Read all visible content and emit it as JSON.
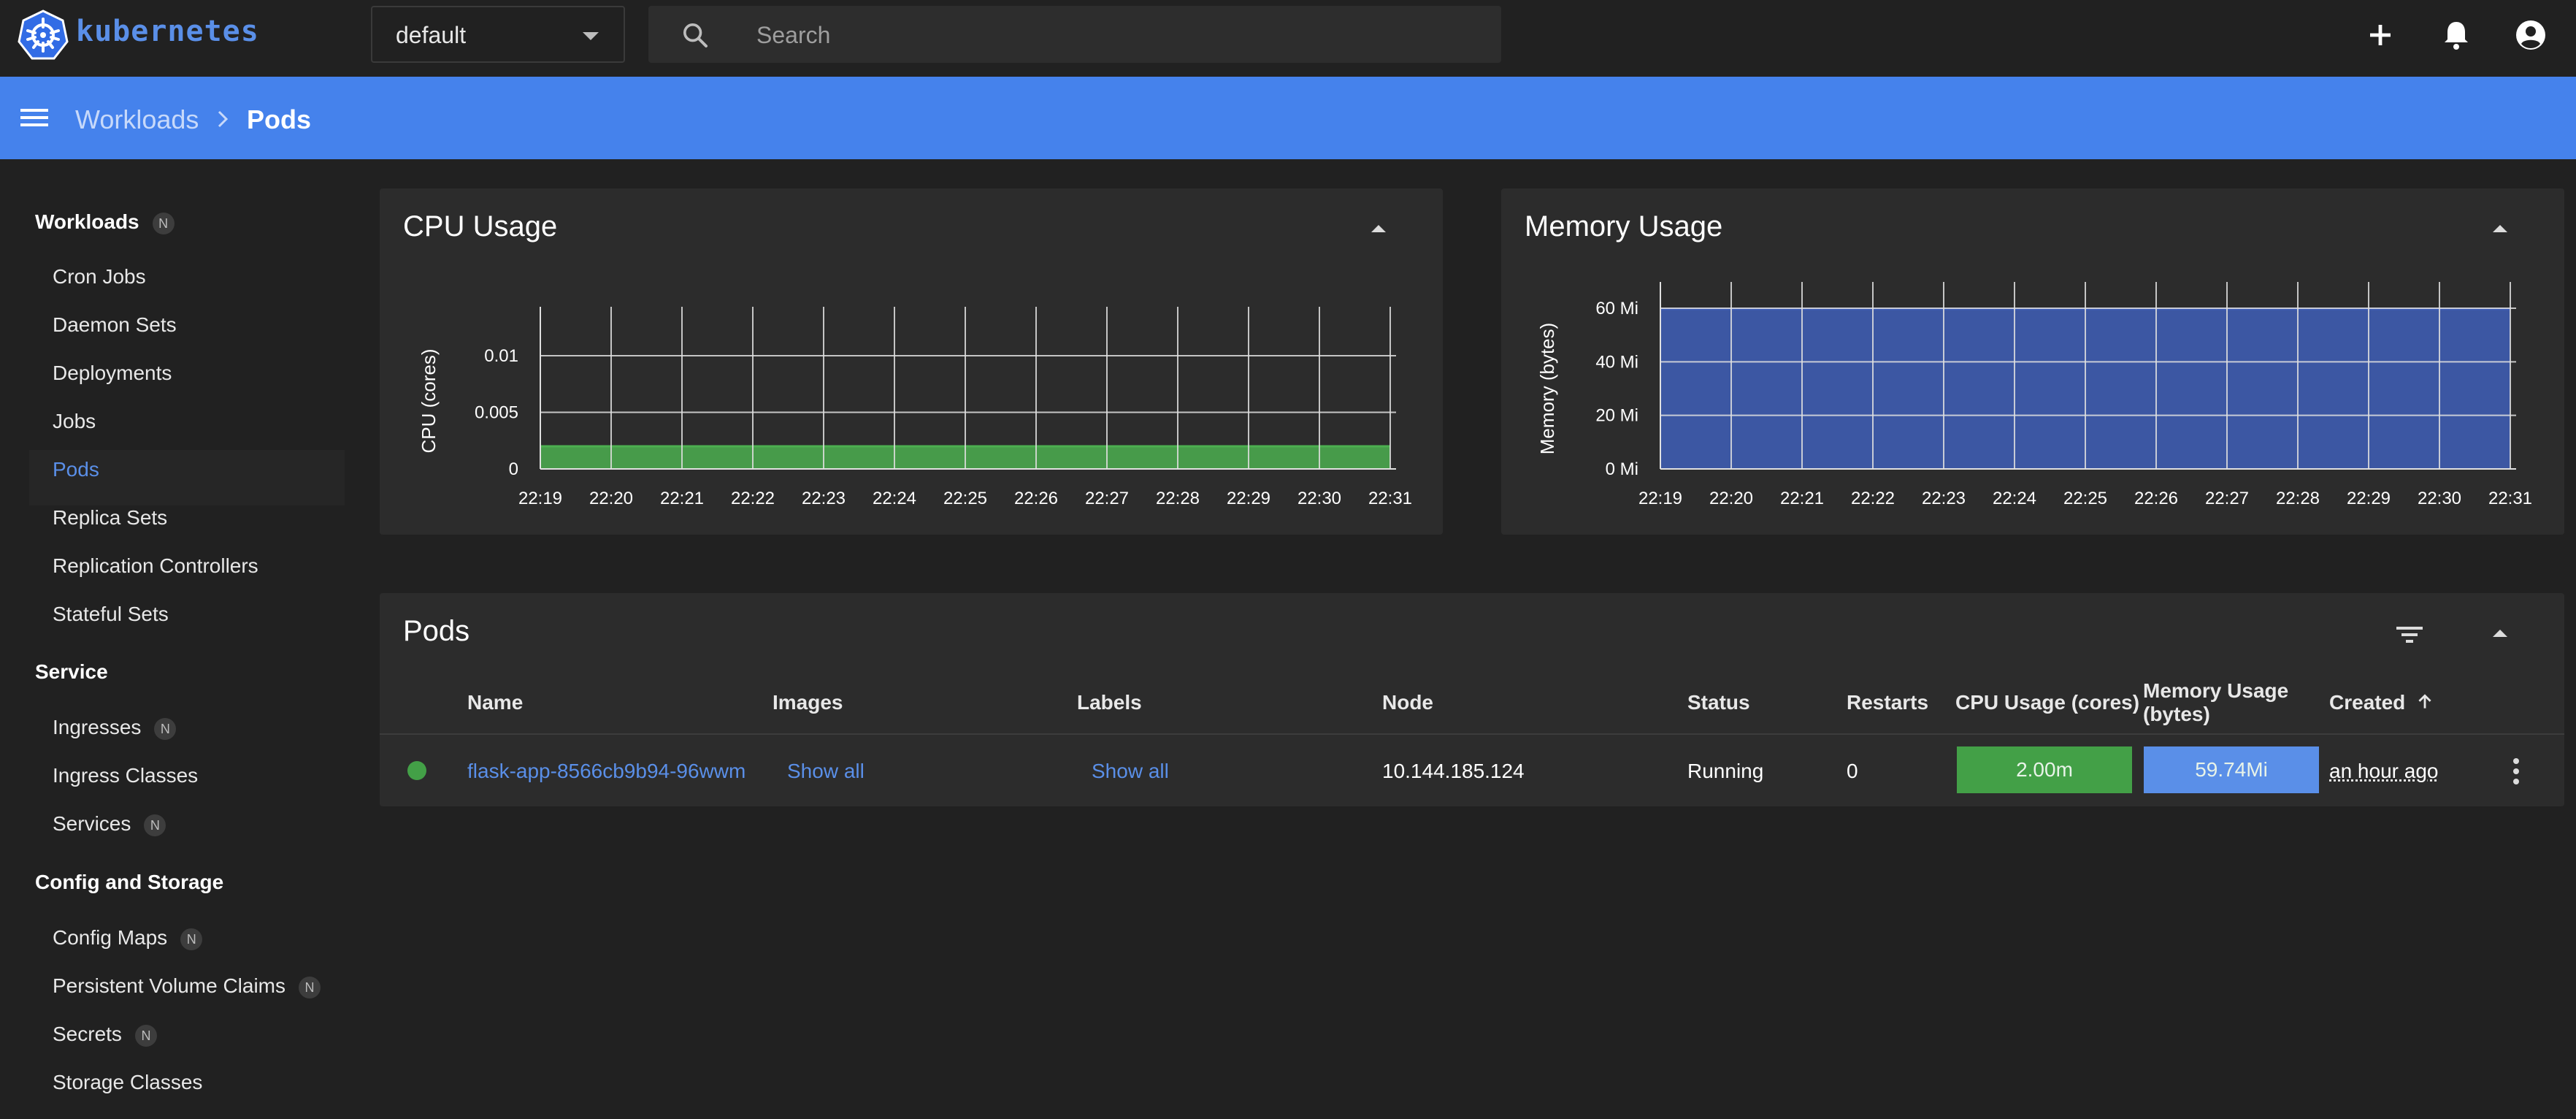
{
  "app": {
    "brand": "kubernetes"
  },
  "toolbar": {
    "namespace": "default",
    "search_placeholder": "Search",
    "icons": [
      "plus-icon",
      "bell-icon",
      "account-icon"
    ]
  },
  "breadcrumb": {
    "parent": "Workloads",
    "current": "Pods"
  },
  "sidebar": {
    "sections": [
      {
        "label": "Workloads",
        "badge": "N",
        "items": [
          {
            "label": "Cron Jobs"
          },
          {
            "label": "Daemon Sets"
          },
          {
            "label": "Deployments"
          },
          {
            "label": "Jobs"
          },
          {
            "label": "Pods",
            "active": true
          },
          {
            "label": "Replica Sets"
          },
          {
            "label": "Replication Controllers"
          },
          {
            "label": "Stateful Sets"
          }
        ]
      },
      {
        "label": "Service",
        "items": [
          {
            "label": "Ingresses",
            "badge": "N"
          },
          {
            "label": "Ingress Classes"
          },
          {
            "label": "Services",
            "badge": "N"
          }
        ]
      },
      {
        "label": "Config and Storage",
        "items": [
          {
            "label": "Config Maps",
            "badge": "N"
          },
          {
            "label": "Persistent Volume Claims",
            "badge": "N"
          },
          {
            "label": "Secrets",
            "badge": "N"
          },
          {
            "label": "Storage Classes"
          }
        ]
      }
    ]
  },
  "cpu_card": {
    "title": "CPU Usage"
  },
  "memory_card": {
    "title": "Memory Usage"
  },
  "pods_card": {
    "title": "Pods"
  },
  "chart_data": [
    {
      "type": "area",
      "title": "CPU Usage",
      "ylabel": "CPU (cores)",
      "x": [
        "22:19",
        "22:20",
        "22:21",
        "22:22",
        "22:23",
        "22:24",
        "22:25",
        "22:26",
        "22:27",
        "22:28",
        "22:29",
        "22:30",
        "22:31"
      ],
      "y_ticks": [
        "0",
        "0.005",
        "0.01"
      ],
      "ylim": [
        0,
        0.012
      ],
      "series": [
        {
          "values": [
            0.002,
            0.002,
            0.002,
            0.002,
            0.002,
            0.002,
            0.002,
            0.002,
            0.002,
            0.002,
            0.002,
            0.002,
            0.002
          ]
        }
      ],
      "color": "#4caf50",
      "grid": true
    },
    {
      "type": "area",
      "title": "Memory Usage",
      "ylabel": "Memory (bytes)",
      "x": [
        "22:19",
        "22:20",
        "22:21",
        "22:22",
        "22:23",
        "22:24",
        "22:25",
        "22:26",
        "22:27",
        "22:28",
        "22:29",
        "22:30",
        "22:31"
      ],
      "y_ticks": [
        "0 Mi",
        "20 Mi",
        "40 Mi",
        "60 Mi"
      ],
      "ylim": [
        0,
        60
      ],
      "series": [
        {
          "values": [
            59.74,
            59.74,
            59.74,
            59.74,
            59.74,
            59.74,
            59.74,
            59.74,
            59.74,
            59.74,
            59.74,
            59.74,
            59.74
          ]
        }
      ],
      "color": "#3f5fb8",
      "grid": true
    }
  ],
  "pods_table": {
    "columns": [
      "Name",
      "Images",
      "Labels",
      "Node",
      "Status",
      "Restarts",
      "CPU Usage (cores)",
      "Memory Usage",
      "(bytes)",
      "Created"
    ],
    "rows": [
      {
        "status_color": "#43a047",
        "name": "flask-app-8566cb9b94-96wwm",
        "images": "Show all",
        "labels": "Show all",
        "node": "10.144.185.124",
        "status": "Running",
        "restarts": "0",
        "cpu": "2.00m",
        "memory": "59.74Mi",
        "created": "an hour ago"
      }
    ]
  }
}
